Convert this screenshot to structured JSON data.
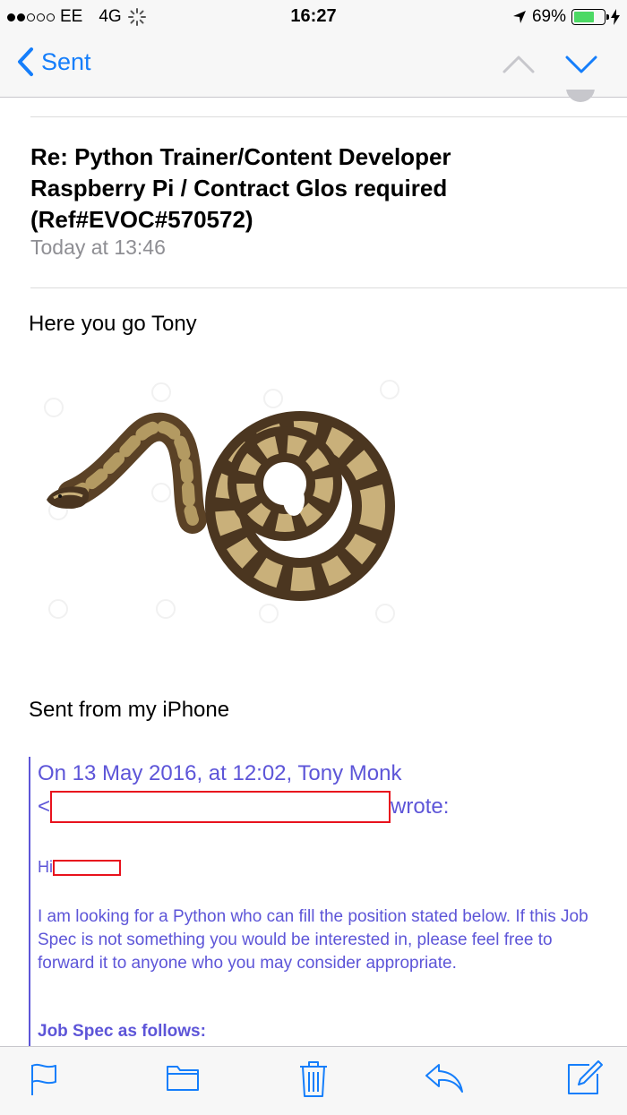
{
  "status_bar": {
    "carrier": "EE",
    "network": "4G",
    "time": "16:27",
    "battery_percent": "69%",
    "battery_level": 0.69
  },
  "nav": {
    "back_label": "Sent"
  },
  "email": {
    "subject": "Re: Python Trainer/Content Developer Raspberry Pi / Contract Glos required (Ref#EVOC#570572)",
    "date": "Today at 13:46",
    "greeting": "Here you go Tony",
    "signature": "Sent from my iPhone",
    "quoted": {
      "header_line1": "On 13 May 2016, at 12:02, Tony Monk",
      "header_lt": "<",
      "header_wrote": "wrote:",
      "hi": "Hi",
      "paragraph": "I am looking for a Python who can fill the position stated below. If this Job Spec is not something you would be interested in, please feel free to forward it to anyone who you may consider appropriate.",
      "job_spec_heading": "Job Spec as follows:"
    }
  },
  "colors": {
    "ios_blue": "#157efb",
    "quote_purple": "#5d55d8",
    "redaction_red": "#e8121d",
    "battery_green": "#4cd964"
  },
  "toolbar": {
    "icons": [
      "flag-icon",
      "folder-icon",
      "trash-icon",
      "reply-icon",
      "compose-icon"
    ]
  }
}
